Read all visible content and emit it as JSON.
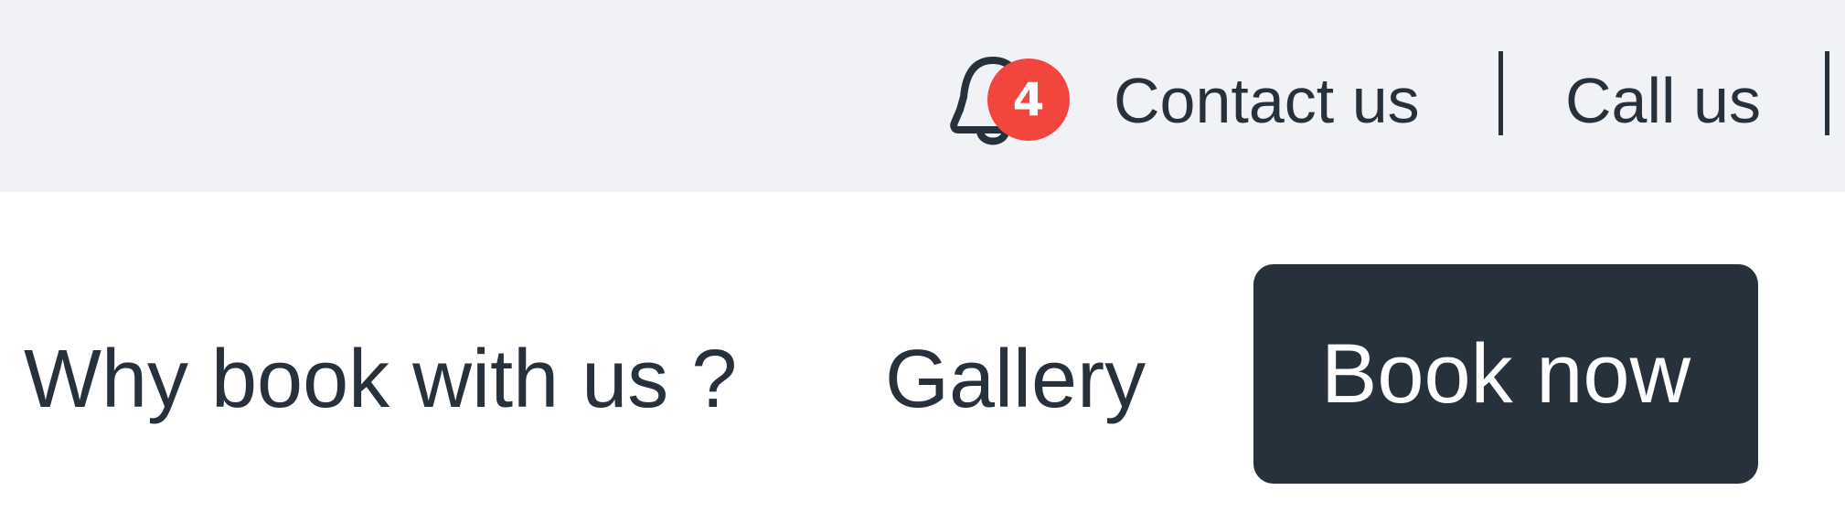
{
  "topbar": {
    "notifications": {
      "count": "4",
      "icon": "bell-icon"
    },
    "links": [
      {
        "label": "Contact us"
      },
      {
        "label": "Call us"
      }
    ]
  },
  "nav": {
    "items": [
      {
        "label": "Why book with us ?"
      },
      {
        "label": "Gallery"
      }
    ],
    "cta_label": "Book now"
  },
  "colors": {
    "topbar_bg": "#f0f2f5",
    "text": "#27313c",
    "badge": "#f2453d",
    "cta_bg": "#27313c",
    "cta_text": "#ffffff"
  }
}
